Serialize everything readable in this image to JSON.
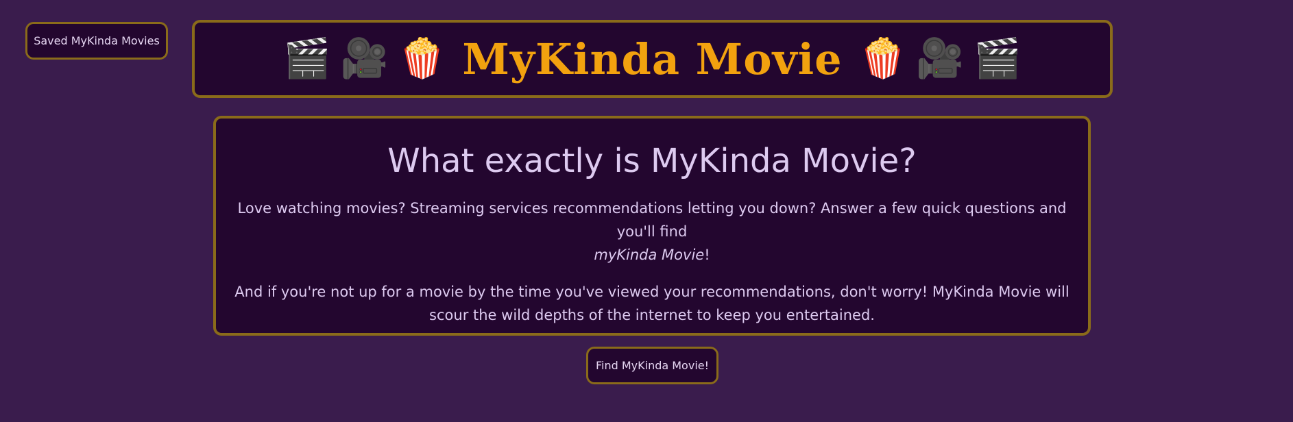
{
  "nav": {
    "saved_label": "Saved MyKinda Movies"
  },
  "header": {
    "title": "MyKinda Movie",
    "icons": [
      "clapper-board",
      "movie-camera",
      "popcorn",
      "popcorn",
      "movie-camera",
      "clapper-board"
    ],
    "title_color": "#f2a20f"
  },
  "info": {
    "heading": "What exactly is MyKinda Movie?",
    "p1_text": "Love watching movies? Streaming services recommendations letting you down? Answer a few quick questions and you'll find",
    "p1_emphasis": "myKinda Movie",
    "p1_end": "!",
    "p2": "And if you're not up for a movie by the time you've viewed your recommendations, don't worry! MyKinda Movie will scour the wild depths of the internet to keep you entertained."
  },
  "cta": {
    "find_label": "Find MyKinda Movie!"
  },
  "colors": {
    "background": "#3a1c4d",
    "panel": "#23062f",
    "border": "#8a6b1a",
    "text": "#ddcaf0"
  }
}
